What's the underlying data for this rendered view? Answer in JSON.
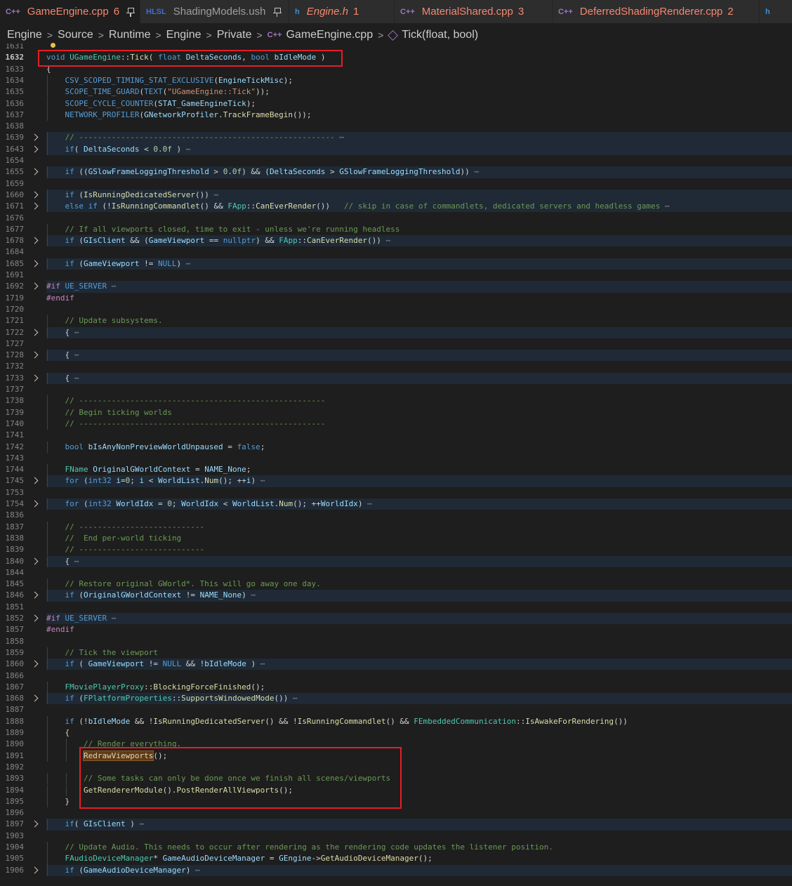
{
  "tabs": [
    {
      "icon": "C++",
      "name": "GameEngine.cpp",
      "count": "6",
      "pinned": true,
      "active": true,
      "err": true,
      "italic": false,
      "iconColor": "#a074c4"
    },
    {
      "icon": "HLSL",
      "name": "ShadingModels.ush",
      "count": "",
      "pinned": true,
      "active": false,
      "err": false,
      "italic": false,
      "iconColor": "#3b6fd4"
    },
    {
      "icon": "h",
      "name": "Engine.h",
      "count": "1",
      "pinned": false,
      "active": false,
      "err": true,
      "italic": true,
      "iconColor": "#3b8fd4"
    },
    {
      "icon": "C++",
      "name": "MaterialShared.cpp",
      "count": "3",
      "pinned": false,
      "active": false,
      "err": true,
      "italic": false,
      "iconColor": "#a074c4"
    },
    {
      "icon": "C++",
      "name": "DeferredShadingRenderer.cpp",
      "count": "2",
      "pinned": false,
      "active": false,
      "err": true,
      "italic": false,
      "iconColor": "#a074c4"
    },
    {
      "icon": "h",
      "name": "",
      "count": "",
      "pinned": false,
      "active": false,
      "err": false,
      "italic": false,
      "iconColor": "#3b8fd4"
    }
  ],
  "breadcrumb": {
    "items": [
      "Engine",
      "Source",
      "Runtime",
      "Engine",
      "Private"
    ],
    "file": "GameEngine.cpp",
    "file_icon": "C++",
    "symbol": "Tick(float, bool)",
    "separator": ">"
  },
  "colors": {
    "background": "#1e1e1e",
    "keyword": "#569cd6",
    "function": "#dcdcaa",
    "comment": "#6a9955",
    "string": "#ce9178",
    "number": "#b5cea8",
    "type": "#4ec9b0",
    "highlight_box": "#e51e25"
  },
  "code": [
    {
      "n": "1631",
      "t": "",
      "fold": false
    },
    {
      "n": "1632",
      "t": "void UGameEngine::Tick( float DeltaSeconds, bool bIdleMode )",
      "fold": false,
      "cur": true
    },
    {
      "n": "1633",
      "t": "{",
      "fold": false
    },
    {
      "n": "1634",
      "t": "    CSV_SCOPED_TIMING_STAT_EXCLUSIVE(EngineTickMisc);",
      "fold": false
    },
    {
      "n": "1635",
      "t": "    SCOPE_TIME_GUARD(TEXT(\"UGameEngine::Tick\"));",
      "fold": false
    },
    {
      "n": "1636",
      "t": "    SCOPE_CYCLE_COUNTER(STAT_GameEngineTick);",
      "fold": false
    },
    {
      "n": "1637",
      "t": "    NETWORK_PROFILER(GNetworkProfiler.TrackFrameBegin());",
      "fold": false
    },
    {
      "n": "1638",
      "t": "",
      "fold": false
    },
    {
      "n": "1639",
      "t": "    // -------------------------------------------------------",
      "fold": true
    },
    {
      "n": "1643",
      "t": "    if( DeltaSeconds < 0.0f )",
      "fold": true
    },
    {
      "n": "1654",
      "t": "",
      "fold": false
    },
    {
      "n": "1655",
      "t": "    if ((GSlowFrameLoggingThreshold > 0.0f) && (DeltaSeconds > GSlowFrameLoggingThreshold))",
      "fold": true
    },
    {
      "n": "1659",
      "t": "",
      "fold": false
    },
    {
      "n": "1660",
      "t": "    if (IsRunningDedicatedServer())",
      "fold": true
    },
    {
      "n": "1671",
      "t": "    else if (!IsRunningCommandlet() && FApp::CanEverRender())   // skip in case of commandlets, dedicated servers and headless games",
      "fold": true
    },
    {
      "n": "1676",
      "t": "",
      "fold": false
    },
    {
      "n": "1677",
      "t": "    // If all viewports closed, time to exit - unless we're running headless",
      "fold": false
    },
    {
      "n": "1678",
      "t": "    if (GIsClient && (GameViewport == nullptr) && FApp::CanEverRender())",
      "fold": true
    },
    {
      "n": "1684",
      "t": "",
      "fold": false
    },
    {
      "n": "1685",
      "t": "    if (GameViewport != NULL)",
      "fold": true
    },
    {
      "n": "1691",
      "t": "",
      "fold": false
    },
    {
      "n": "1692",
      "t": "#if !UE_SERVER",
      "fold": true
    },
    {
      "n": "1719",
      "t": "#endif",
      "fold": false
    },
    {
      "n": "1720",
      "t": "",
      "fold": false
    },
    {
      "n": "1721",
      "t": "    // Update subsystems.",
      "fold": false
    },
    {
      "n": "1722",
      "t": "    {",
      "fold": true
    },
    {
      "n": "1727",
      "t": "",
      "fold": false
    },
    {
      "n": "1728",
      "t": "    {",
      "fold": true
    },
    {
      "n": "1732",
      "t": "",
      "fold": false
    },
    {
      "n": "1733",
      "t": "    {",
      "fold": true
    },
    {
      "n": "1737",
      "t": "",
      "fold": false
    },
    {
      "n": "1738",
      "t": "    // -----------------------------------------------------",
      "fold": false
    },
    {
      "n": "1739",
      "t": "    // Begin ticking worlds",
      "fold": false
    },
    {
      "n": "1740",
      "t": "    // -----------------------------------------------------",
      "fold": false
    },
    {
      "n": "1741",
      "t": "",
      "fold": false
    },
    {
      "n": "1742",
      "t": "    bool bIsAnyNonPreviewWorldUnpaused = false;",
      "fold": false
    },
    {
      "n": "1743",
      "t": "",
      "fold": false
    },
    {
      "n": "1744",
      "t": "    FName OriginalGWorldContext = NAME_None;",
      "fold": false
    },
    {
      "n": "1745",
      "t": "    for (int32 i=0; i < WorldList.Num(); ++i)",
      "fold": true
    },
    {
      "n": "1753",
      "t": "",
      "fold": false
    },
    {
      "n": "1754",
      "t": "    for (int32 WorldIdx = 0; WorldIdx < WorldList.Num(); ++WorldIdx)",
      "fold": true
    },
    {
      "n": "1836",
      "t": "",
      "fold": false
    },
    {
      "n": "1837",
      "t": "    // ---------------------------",
      "fold": false
    },
    {
      "n": "1838",
      "t": "    //  End per-world ticking",
      "fold": false
    },
    {
      "n": "1839",
      "t": "    // ---------------------------",
      "fold": false
    },
    {
      "n": "1840",
      "t": "    {",
      "fold": true
    },
    {
      "n": "1844",
      "t": "",
      "fold": false
    },
    {
      "n": "1845",
      "t": "    // Restore original GWorld*. This will go away one day.",
      "fold": false
    },
    {
      "n": "1846",
      "t": "    if (OriginalGWorldContext != NAME_None)",
      "fold": true
    },
    {
      "n": "1851",
      "t": "",
      "fold": false
    },
    {
      "n": "1852",
      "t": "#if !UE_SERVER",
      "fold": true
    },
    {
      "n": "1857",
      "t": "#endif",
      "fold": false
    },
    {
      "n": "1858",
      "t": "",
      "fold": false
    },
    {
      "n": "1859",
      "t": "    // Tick the viewport",
      "fold": false
    },
    {
      "n": "1860",
      "t": "    if ( GameViewport != NULL && !bIdleMode )",
      "fold": true
    },
    {
      "n": "1866",
      "t": "",
      "fold": false
    },
    {
      "n": "1867",
      "t": "    FMoviePlayerProxy::BlockingForceFinished();",
      "fold": false
    },
    {
      "n": "1868",
      "t": "    if (FPlatformProperties::SupportsWindowedMode())",
      "fold": true
    },
    {
      "n": "1887",
      "t": "",
      "fold": false
    },
    {
      "n": "1888",
      "t": "    if (!bIdleMode && !IsRunningDedicatedServer() && !IsRunningCommandlet() && FEmbeddedCommunication::IsAwakeForRendering())",
      "fold": false
    },
    {
      "n": "1889",
      "t": "    {",
      "fold": false
    },
    {
      "n": "1890",
      "t": "        // Render everything.",
      "fold": false
    },
    {
      "n": "1891",
      "t": "        RedrawViewports();",
      "fold": false
    },
    {
      "n": "1892",
      "t": "",
      "fold": false
    },
    {
      "n": "1893",
      "t": "        // Some tasks can only be done once we finish all scenes/viewports",
      "fold": false
    },
    {
      "n": "1894",
      "t": "        GetRendererModule().PostRenderAllViewports();",
      "fold": false
    },
    {
      "n": "1895",
      "t": "    }",
      "fold": false
    },
    {
      "n": "1896",
      "t": "",
      "fold": false
    },
    {
      "n": "1897",
      "t": "    if( GIsClient )",
      "fold": true
    },
    {
      "n": "1903",
      "t": "",
      "fold": false
    },
    {
      "n": "1904",
      "t": "    // Update Audio. This needs to occur after rendering as the rendering code updates the listener position.",
      "fold": false
    },
    {
      "n": "1905",
      "t": "    FAudioDeviceManager* GameAudioDeviceManager = GEngine->GetAudioDeviceManager();",
      "fold": false
    },
    {
      "n": "1906",
      "t": "    if (GameAudioDeviceManager)",
      "fold": true
    }
  ]
}
